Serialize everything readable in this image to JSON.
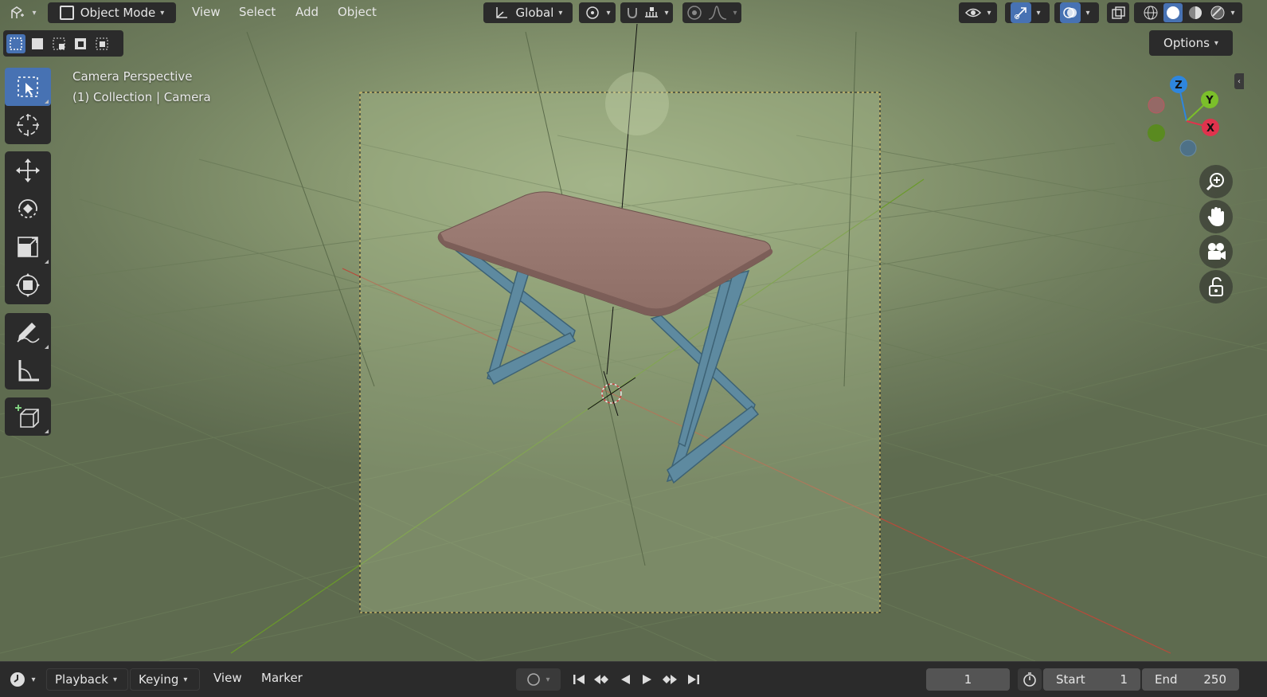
{
  "header": {
    "mode_label": "Object Mode",
    "menus": [
      "View",
      "Select",
      "Add",
      "Object"
    ],
    "transform_orientation": "Global",
    "options_label": "Options"
  },
  "viewport": {
    "view_name": "Camera Perspective",
    "collection_label": "(1) Collection | Camera",
    "background_color": "#7a8a64",
    "table_top_color": "#9b7a72",
    "table_leg_color": "#5e8aa0",
    "camera_frame_color": "#e0c060"
  },
  "gizmo": {
    "axes": [
      "Z",
      "Y",
      "X"
    ],
    "colors": {
      "x": "#e0334d",
      "y": "#7bbf2a",
      "z": "#2e86de"
    }
  },
  "nav_buttons": [
    "zoom-icon",
    "hand-pan-icon",
    "camera-view-icon",
    "lock-icon"
  ],
  "tools": [
    "select-box-icon",
    "cursor-icon",
    "move-icon",
    "rotate-icon",
    "scale-icon",
    "transform-icon",
    "annotate-icon",
    "measure-icon",
    "add-cube-icon"
  ],
  "timeline": {
    "menus": [
      "Playback",
      "Keying",
      "View",
      "Marker"
    ],
    "current_frame": "1",
    "start_label": "Start",
    "start_value": "1",
    "end_label": "End",
    "end_value": "250"
  }
}
